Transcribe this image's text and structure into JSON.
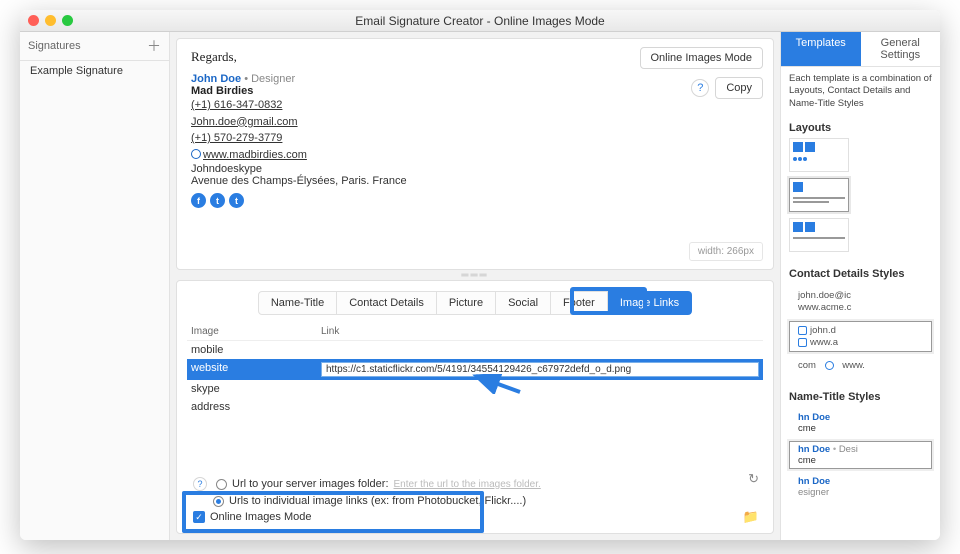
{
  "window": {
    "title": "Email Signature Creator - Online Images Mode"
  },
  "left": {
    "header": "Signatures",
    "item": "Example Signature"
  },
  "preview": {
    "salutation": "Regards,",
    "name": "John Doe",
    "role": "Designer",
    "company": "Mad Birdies",
    "phone1": "(+1) 616-347-0832",
    "email": "John.doe@gmail.com",
    "phone2": "(+1) 570-279-3779",
    "website": "www.madbirdies.com",
    "skype": "Johndoeskype",
    "address": "Avenue des Champs-Élysées, Paris. France",
    "mode_btn": "Online Images Mode",
    "copy_btn": "Copy",
    "width_label": "width: 266px"
  },
  "tabs": {
    "t1": "Name-Title",
    "t2": "Contact Details",
    "t3": "Picture",
    "t4": "Social",
    "t5": "Footer",
    "t6": "Image Links"
  },
  "table": {
    "h1": "Image",
    "h2": "Link",
    "r1": "mobile",
    "r2": "website",
    "r3": "skype",
    "r4": "address",
    "link_val": "https://c1.staticflickr.com/5/4191/34554129426_c67972defd_o_d.png"
  },
  "opts": {
    "folder_label": "Url to your server images folder:",
    "folder_hint": "Enter the url to the images folder.",
    "individual": "Urls to individual image links (ex: from Photobucket, Flickr....)",
    "online_mode": "Online Images Mode"
  },
  "right": {
    "tab1": "Templates",
    "tab2": "General Settings",
    "desc": "Each template is a combination of Layouts, Contact Details and Name-Title Styles",
    "layouts_h": "Layouts",
    "cds_h": "Contact Details Styles",
    "nts_h": "Name-Title Styles",
    "cd1a": "john.doe@ic",
    "cd1b": "www.acme.c",
    "cd2a": "john.d",
    "cd2b": "www.a",
    "cd3a": "com",
    "cd3b": "www.",
    "nt_name": "hn Doe",
    "nt_co": "cme",
    "nt_role": "esigner",
    "nt_role2": "Desi"
  }
}
